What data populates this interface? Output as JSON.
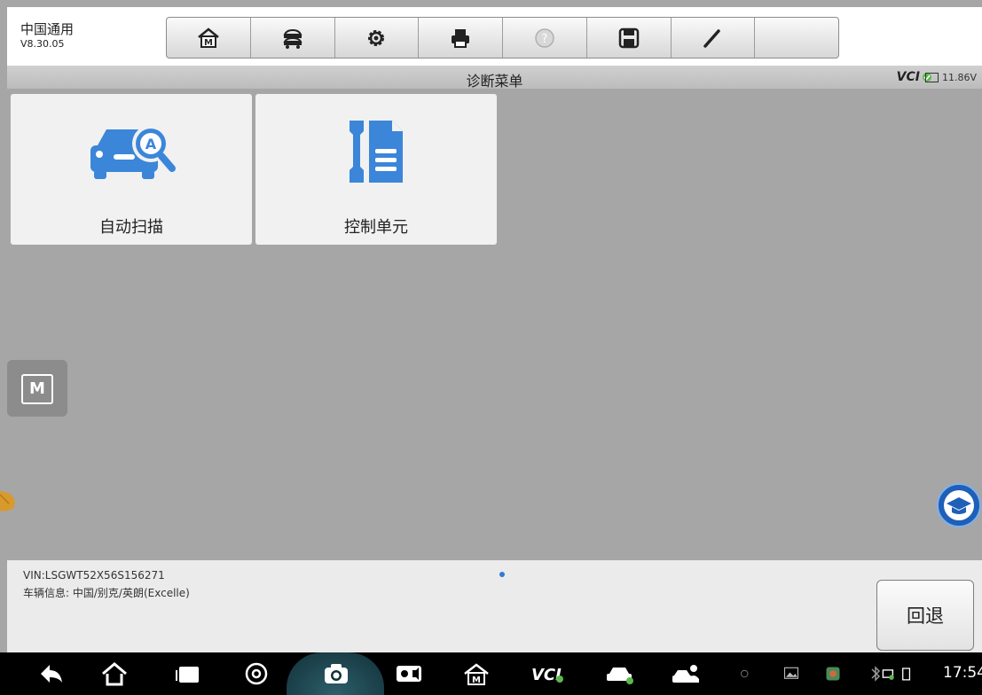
{
  "app": {
    "title": "中国通用",
    "version": "V8.30.05"
  },
  "toolbar": {
    "buttons": [
      "home-icon",
      "vehicle-swap-icon",
      "settings-icon",
      "print-icon",
      "help-icon",
      "save-icon",
      "edit-icon"
    ]
  },
  "header": {
    "title": "诊断菜单",
    "vci": "VCI",
    "voltage": "11.86V"
  },
  "tiles": [
    {
      "label": "自动扫描",
      "icon": "car-search-icon"
    },
    {
      "label": "控制单元",
      "icon": "wrench-document-icon"
    }
  ],
  "footer": {
    "vin": "VIN:LSGWT52X56S156271",
    "vehicle_info": "车辆信息: 中国/别克/英朗(Excelle)",
    "back_label": "回退"
  },
  "statusbar": {
    "time": "17:54"
  },
  "colors": {
    "accent_blue": "#3b86d9",
    "background": "#a6a6a6",
    "vci_green": "#5db84a"
  }
}
